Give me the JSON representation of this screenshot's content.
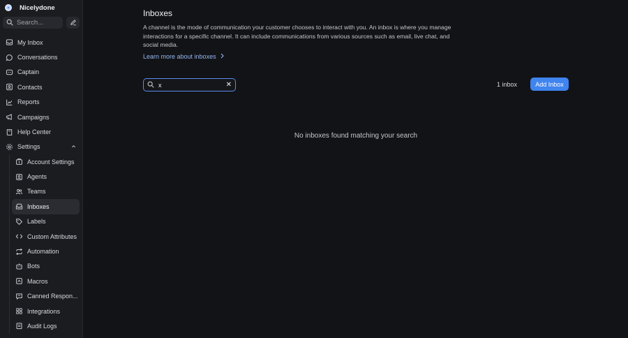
{
  "sidebar": {
    "account_name": "Nicelydone",
    "search_label": "Search...",
    "nav": [
      {
        "label": "My Inbox"
      },
      {
        "label": "Conversations"
      },
      {
        "label": "Captain"
      },
      {
        "label": "Contacts"
      },
      {
        "label": "Reports"
      },
      {
        "label": "Campaigns"
      },
      {
        "label": "Help Center"
      },
      {
        "label": "Settings"
      }
    ],
    "settings_items": [
      {
        "label": "Account Settings"
      },
      {
        "label": "Agents"
      },
      {
        "label": "Teams"
      },
      {
        "label": "Inboxes"
      },
      {
        "label": "Labels"
      },
      {
        "label": "Custom Attributes"
      },
      {
        "label": "Automation"
      },
      {
        "label": "Bots"
      },
      {
        "label": "Macros"
      },
      {
        "label": "Canned Respon..."
      },
      {
        "label": "Integrations"
      },
      {
        "label": "Audit Logs"
      }
    ]
  },
  "main": {
    "title": "Inboxes",
    "description": "A channel is the mode of communication your customer chooses to interact with you. An inbox is where you manage interactions for a specific channel. It can include communications from various sources such as email, live chat, and social media.",
    "learn_more": "Learn more about inboxes",
    "search_value": "x",
    "count": "1 inbox",
    "add_button": "Add Inbox",
    "empty_message": "No inboxes found matching your search"
  },
  "colors": {
    "accent": "#3f84ef",
    "background": "#121316",
    "sidebar": "#1b1c20"
  }
}
